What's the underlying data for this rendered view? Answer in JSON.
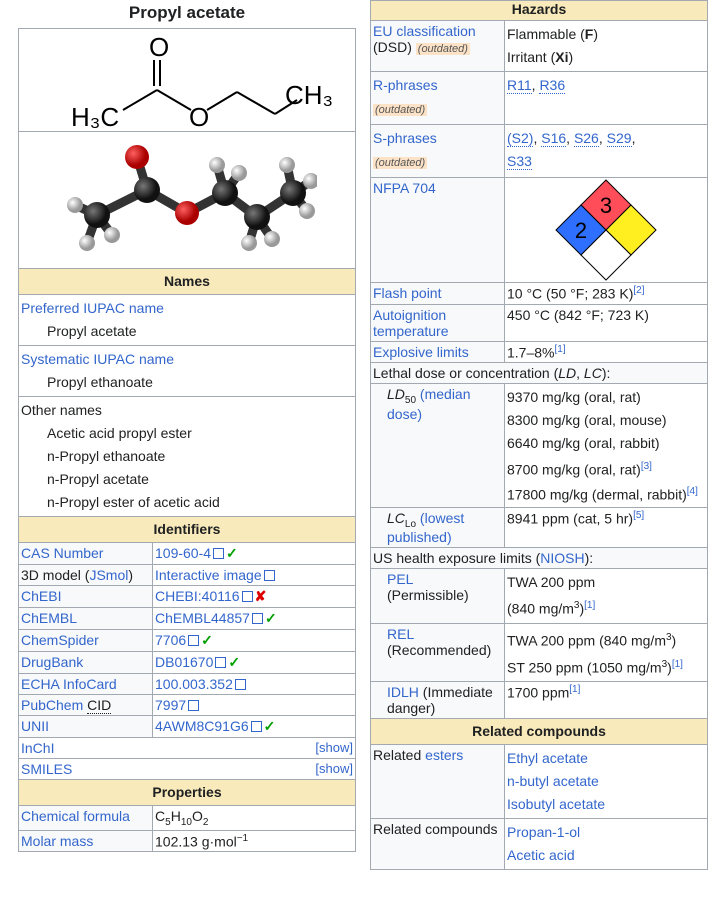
{
  "title": "Propyl acetate",
  "structure": {
    "o": "O",
    "h3c": "H₃C",
    "o2": "O",
    "ch3": "CH₃"
  },
  "names": {
    "header": "Names",
    "preferred_label": "Preferred IUPAC name",
    "preferred_value": "Propyl acetate",
    "systematic_label": "Systematic IUPAC name",
    "systematic_value": "Propyl ethanoate",
    "other_label": "Other names",
    "other_values": [
      "Acetic acid propyl ester",
      "n-Propyl ethanoate",
      "n-Propyl acetate",
      "n-Propyl ester of acetic acid"
    ]
  },
  "identifiers": {
    "header": "Identifiers",
    "cas": {
      "label": "CAS Number",
      "value": "109-60-4"
    },
    "model3d": {
      "label_a": "3D model (",
      "label_b": "JSmol",
      "label_c": ")",
      "value": "Interactive image"
    },
    "chebi": {
      "label": "ChEBI",
      "value": "CHEBI:40116"
    },
    "chembl": {
      "label": "ChEMBL",
      "value": "ChEMBL44857"
    },
    "chemspider": {
      "label": "ChemSpider",
      "value": "7706"
    },
    "drugbank": {
      "label": "DrugBank",
      "value": "DB01670"
    },
    "echa": {
      "label": "ECHA InfoCard",
      "value": "100.003.352"
    },
    "pubchem": {
      "label_a": "PubChem ",
      "label_b": "CID",
      "value": "7997"
    },
    "unii": {
      "label": "UNII",
      "value": "4AWM8C91G6"
    },
    "inchi": {
      "label": "InChI",
      "show": "[show]"
    },
    "smiles": {
      "label": "SMILES",
      "show": "[show]"
    }
  },
  "properties": {
    "header": "Properties",
    "formula": {
      "label": "Chemical formula",
      "c": "C",
      "c_n": "5",
      "h": "H",
      "h_n": "10",
      "o": "O",
      "o_n": "2"
    },
    "molar": {
      "label": "Molar mass",
      "value": "102.13 g·mol",
      "exp": "−1"
    }
  },
  "hazards": {
    "header": "Hazards",
    "eu": {
      "label_a": "EU classification",
      "label_b": " (DSD) ",
      "outdated": "(outdated)",
      "flammable_a": "Flammable (",
      "flammable_b": "F",
      "flammable_c": ")",
      "irritant_a": "Irritant (",
      "irritant_b": "Xi",
      "irritant_c": ")"
    },
    "r": {
      "label": "R-phrases",
      "outdated": "(outdated)",
      "v1": "R11",
      "sep": ", ",
      "v2": "R36"
    },
    "s": {
      "label": "S-phrases",
      "outdated": "(outdated)",
      "v1": "(S2)",
      "v2": "S16",
      "v3": "S26",
      "v4": "S29",
      "v5": "S33",
      "sep": ", "
    },
    "nfpa": {
      "label": "NFPA 704",
      "top": "3",
      "left": "2",
      "right": "",
      "bottom": ""
    },
    "flash": {
      "label": "Flash point",
      "value": "10 °C (50 °F; 283 K)",
      "ref": "[2]"
    },
    "autoign": {
      "label": "Autoignition temperature",
      "value": "450 °C (842 °F; 723 K)"
    },
    "explosive": {
      "label": "Explosive limits",
      "value": "1.7–8%",
      "ref": "[1]"
    },
    "lethal": {
      "a": "Lethal dose or concentration (",
      "b": "LD",
      "c": ", ",
      "d": "LC",
      "e": "):"
    },
    "ld50": {
      "ld": "LD",
      "sub": "50",
      "link": "(median dose)",
      "values": [
        {
          "t": "9370 mg/kg (oral, rat)",
          "r": ""
        },
        {
          "t": "8300 mg/kg (oral, mouse)",
          "r": ""
        },
        {
          "t": "6640 mg/kg (oral, rabbit)",
          "r": ""
        },
        {
          "t": "8700 mg/kg (oral, rat)",
          "r": "[3]"
        },
        {
          "t": "17800 mg/kg (dermal, rabbit)",
          "r": "[4]"
        }
      ]
    },
    "lclo": {
      "lc": "LC",
      "sub": "Lo",
      "link": "(lowest published)",
      "value": "8941 ppm (cat, 5 hr)",
      "ref": "[5]"
    },
    "us": {
      "a": "US health exposure limits (",
      "b": "NIOSH",
      "c": "):"
    },
    "pel": {
      "link": "PEL",
      "label": "(Permissible)",
      "v1": "TWA 200 ppm",
      "v2a": "(840 mg/m",
      "v2b": "3",
      "v2c": ")",
      "ref": "[1]"
    },
    "rel": {
      "link": "REL",
      "label": "(Recommended)",
      "v1a": "TWA 200 ppm (840 mg/m",
      "v1b": "3",
      "v1c": ")",
      "v2a": "ST 250 ppm (1050 mg/m",
      "v2b": "3",
      "v2c": ")",
      "ref": "[1]"
    },
    "idlh": {
      "link": "IDLH",
      "label": " (Immediate danger)",
      "value": "1700 ppm",
      "ref": "[1]"
    }
  },
  "related": {
    "header": "Related compounds",
    "esters_a": "Related ",
    "esters_b": "esters",
    "esters": [
      "Ethyl acetate",
      "n-butyl acetate",
      "Isobutyl acetate"
    ],
    "compounds_label": "Related compounds",
    "compounds": [
      "Propan-1-ol",
      "Acetic acid"
    ]
  }
}
